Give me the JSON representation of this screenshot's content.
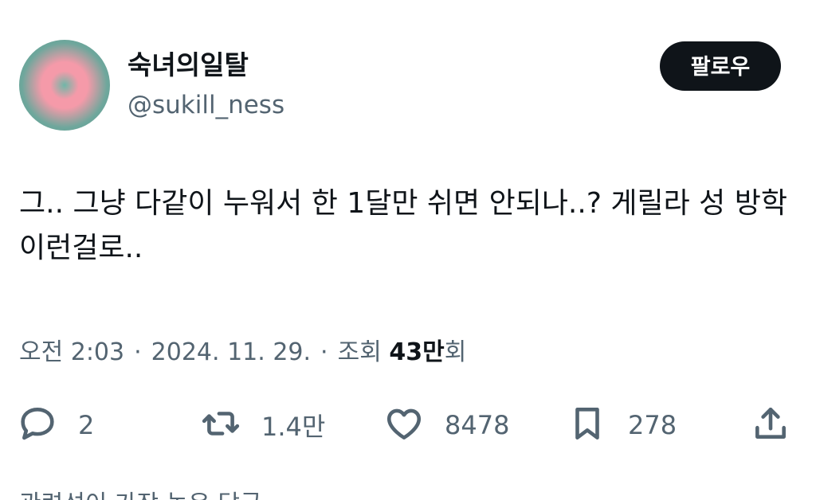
{
  "author": {
    "display_name": "숙녀의일탈",
    "handle": "@sukill_ness"
  },
  "follow_button": {
    "label": "팔로우"
  },
  "tweet": {
    "text": "그.. 그냥 다같이 누워서 한 1달만 쉬면 안되나..? 게릴라 성 방학 이런걸로.."
  },
  "meta": {
    "time": "오전 2:03",
    "separator": "·",
    "date": "2024. 11. 29.",
    "views_label": "조회",
    "views_count": "43만",
    "views_suffix": "회"
  },
  "actions": {
    "replies": "2",
    "retweets": "1.4만",
    "likes": "8478",
    "bookmarks": "278"
  },
  "icons": {
    "reply": "reply-icon",
    "retweet": "retweet-icon",
    "like": "heart-icon",
    "bookmark": "bookmark-icon",
    "share": "share-icon"
  },
  "next_section": {
    "partial_text": "관련성이 가장 높은 답글"
  },
  "colors": {
    "text_primary": "#0f1419",
    "text_secondary": "#536471",
    "button_bg": "#0f1419"
  }
}
